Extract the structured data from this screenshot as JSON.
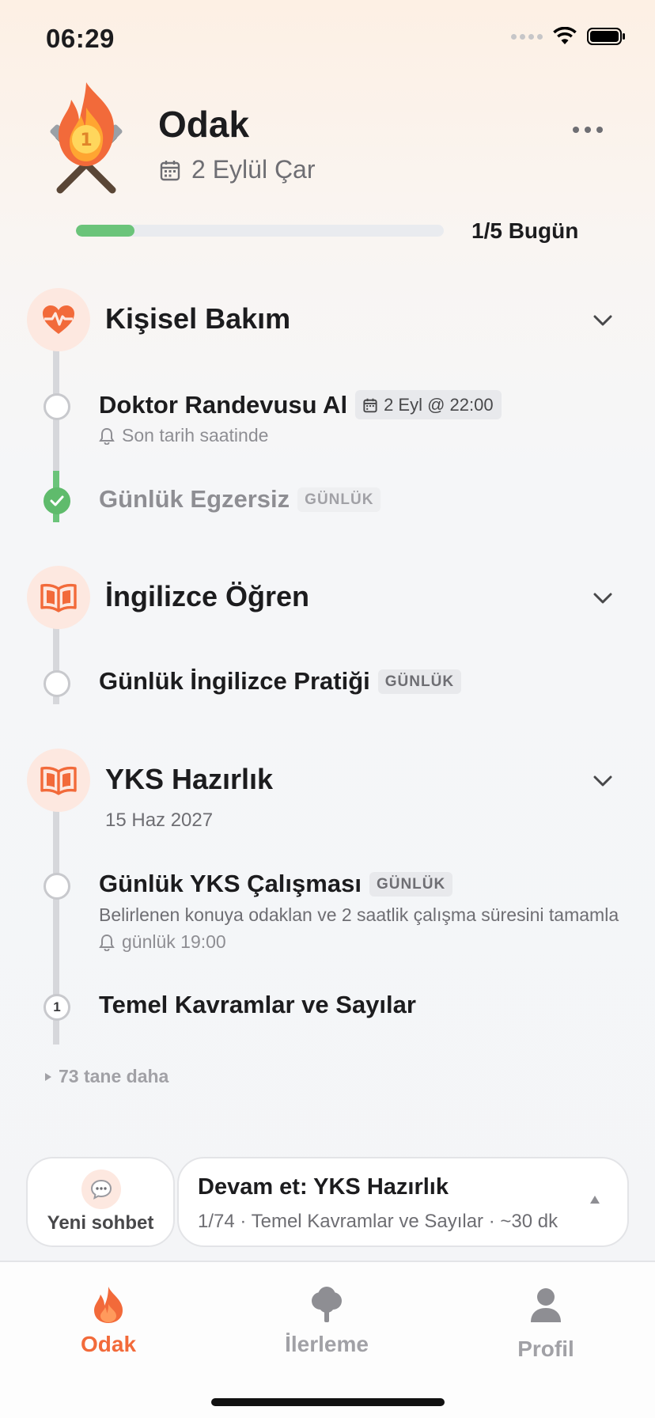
{
  "status_bar": {
    "time": "06:29"
  },
  "header": {
    "title": "Odak",
    "date": "2 Eylül Çar",
    "progress": {
      "label": "1/5 Bugün",
      "value": 0.16
    }
  },
  "sections": [
    {
      "title": "Kişisel Bakım",
      "tasks": [
        {
          "title": "Doktor Randevusu Al",
          "date_tag": "2 Eyl @ 22:00",
          "reminder": "Son tarih saatinde",
          "done": false
        },
        {
          "title": "Günlük Egzersiz",
          "tag": "GÜNLÜK",
          "done": true
        }
      ]
    },
    {
      "title": "İngilizce Öğren",
      "tasks": [
        {
          "title": "Günlük İngilizce Pratiği",
          "tag": "GÜNLÜK",
          "done": false
        }
      ]
    },
    {
      "title": "YKS Hazırlık",
      "subtitle": "15 Haz 2027",
      "tasks": [
        {
          "title": "Günlük YKS Çalışması",
          "tag": "GÜNLÜK",
          "description": "Belirlenen konuya odaklan ve 2 saatlik çalışma süresini tamamla",
          "reminder": "günlük 19:00",
          "done": false
        },
        {
          "title": "Temel Kavramlar ve Sayılar",
          "number": "1",
          "done": false
        }
      ],
      "more": "73 tane daha"
    }
  ],
  "bottom": {
    "new_chat": "Yeni sohbet",
    "continue_title": "Devam et: YKS Hazırlık",
    "continue_sub": "1/74 · Temel Kavramlar ve Sayılar · ~30 dk"
  },
  "tabs": [
    {
      "label": "Odak",
      "icon": "flame-icon"
    },
    {
      "label": "İlerleme",
      "icon": "tree-icon"
    },
    {
      "label": "Profil",
      "icon": "person-icon"
    }
  ],
  "colors": {
    "accent": "#f26a3a",
    "success": "#5fbb6c",
    "section_bg": "#fde8e0"
  }
}
